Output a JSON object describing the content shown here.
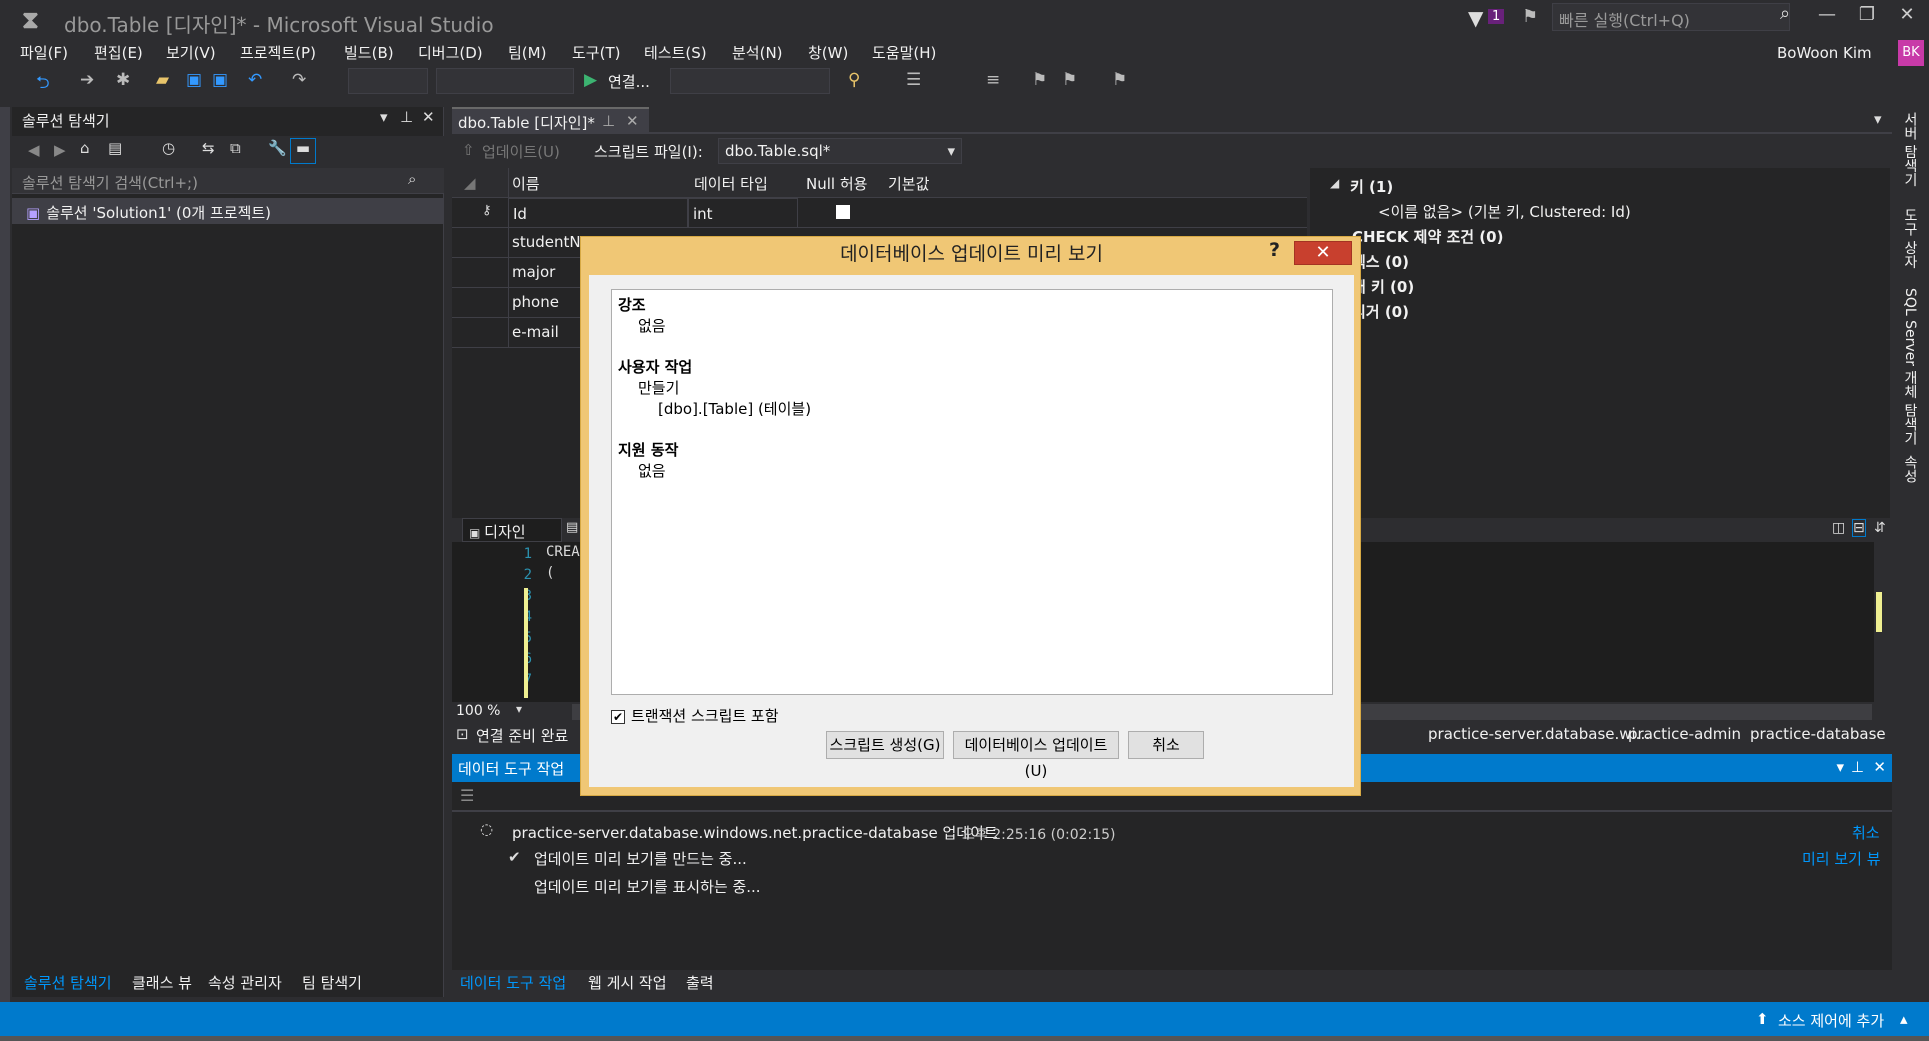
{
  "window": {
    "title": "dbo.Table [디자인]* - Microsoft Visual Studio",
    "notifications": "1",
    "quick_launch": "빠른 실행(Ctrl+Q)",
    "user": "BoWoon Kim",
    "avatar": "BK"
  },
  "menu": [
    "파일(F)",
    "편집(E)",
    "보기(V)",
    "프로젝트(P)",
    "빌드(B)",
    "디버그(D)",
    "팀(M)",
    "도구(T)",
    "테스트(S)",
    "분석(N)",
    "창(W)",
    "도움말(H)"
  ],
  "toolbar": {
    "connect": "연결..."
  },
  "solution_explorer": {
    "title": "솔루션 탐색기",
    "search": "솔루션 탐색기 검색(Ctrl+;)",
    "root": "솔루션 'Solution1' (0개 프로젝트)"
  },
  "left_bottom_tabs": [
    "솔루션 탐색기",
    "클래스 뷰",
    "속성 관리자",
    "팀 탐색기"
  ],
  "doc_tab": {
    "label": "dbo.Table [디자인]*"
  },
  "designer_toolbar": {
    "update": "업데이트(U)",
    "script_file_label": "스크립트 파일(I):",
    "script_file": "dbo.Table.sql*"
  },
  "grid": {
    "headers": [
      "이름",
      "데이터 타입",
      "Null 허용",
      "기본값"
    ],
    "rows": [
      {
        "name": "Id",
        "type": "int"
      },
      {
        "name": "studentNa",
        "type": ""
      },
      {
        "name": "major",
        "type": ""
      },
      {
        "name": "phone",
        "type": ""
      },
      {
        "name": "e-mail",
        "type": ""
      }
    ]
  },
  "properties": {
    "keys": "키 (1)",
    "key_item": "<이름 없음>   (기본 키, Clustered: Id)",
    "check": "CHECK 제약 조건 (0)",
    "index": "덱스 (0)",
    "foreign": "래 키 (0)",
    "trigger": "리거 (0)"
  },
  "script_tabs": {
    "design": "디자인"
  },
  "script": {
    "lines": [
      "1",
      "2",
      "3",
      "4",
      "5",
      "6",
      "7"
    ],
    "code1": "CREA",
    "code2": "("
  },
  "zoom": "100 %",
  "connection": {
    "status": "연결 준비 완료",
    "server": "practice-server.database.wi...",
    "user": "practice-admin",
    "database": "practice-database"
  },
  "data_tools": {
    "title": "데이터 도구 작업",
    "task": "practice-server.database.windows.net.practice-database 업데이트",
    "time": "오후 2:25:16 (0:02:15)",
    "cancel": "취소",
    "preview_view": "미리 보기 뷰",
    "step1": "업데이트 미리 보기를 만드는 중...",
    "step2": "업데이트 미리 보기를 표시하는 중..."
  },
  "right_bottom_tabs": [
    "데이터 도구 작업",
    "웹 게시 작업",
    "출력"
  ],
  "right_rail": [
    "서버 탐색기",
    "도구 상자",
    "SQL Server 개체 탐색기",
    "속성"
  ],
  "status_bar": {
    "source_control": "소스 제어에 추가"
  },
  "dialog": {
    "title": "데이터베이스 업데이트 미리 보기",
    "help": "?",
    "sections": [
      {
        "header": "강조",
        "items": [
          "없음"
        ]
      },
      {
        "header": "사용자 작업",
        "items": [
          "만들기"
        ],
        "sub": [
          "[dbo].[Table] (테이블)"
        ]
      },
      {
        "header": "지원 동작",
        "items": [
          "없음"
        ]
      }
    ],
    "include_transaction": "트랜잭션 스크립트 포함",
    "btn_script": "스크립트 생성(G)",
    "btn_update": "데이터베이스 업데이트(U)",
    "btn_cancel": "취소"
  },
  "colors": {
    "accent": "#007acc",
    "dialog_frame": "#f0c775",
    "close_red": "#c8402e"
  }
}
